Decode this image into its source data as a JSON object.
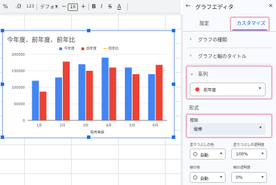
{
  "toolbar": {
    "format_123": "123",
    "font_name": "デフォ...",
    "minus": "−",
    "font_size": "10",
    "plus": "+",
    "bold": "B",
    "italic": "I",
    "strikethrough": "S",
    "text_color": "A"
  },
  "chart": {
    "title": "今年度、前年度、前年比",
    "legend": [
      {
        "name": "今年度",
        "color": "#4285f4",
        "kind": "box"
      },
      {
        "name": "前年度",
        "color": "#ea4335",
        "kind": "box"
      },
      {
        "name": "前年比",
        "color": "#fbbc04",
        "kind": "line"
      }
    ]
  },
  "chart_data": {
    "type": "bar",
    "title": "今年度、前年度、前年比",
    "xlabel": "販売実績",
    "ylabel": "",
    "categories": [
      "1月",
      "2月",
      "3月",
      "4月",
      "5月",
      "6月"
    ],
    "series": [
      {
        "name": "今年度",
        "color": "#4285f4",
        "values": [
          120000,
          130000,
          170000,
          190000,
          160000,
          140000
        ]
      },
      {
        "name": "前年度",
        "color": "#ea4335",
        "values": [
          87000,
          178000,
          150000,
          160000,
          140000,
          168000
        ]
      },
      {
        "name": "前年比",
        "color": "#fbbc04",
        "values": []
      }
    ],
    "yticks": [
      "0",
      "50000",
      "100000",
      "150000",
      "200000"
    ],
    "ylim": [
      0,
      200000
    ],
    "grid": true,
    "legend_position": "top"
  },
  "panel": {
    "title": "グラフエディタ",
    "back_icon": "arrow-back-icon",
    "close_icon": "close-icon",
    "tabs": {
      "setup": "設定",
      "customize": "カスタマイズ"
    },
    "sections": {
      "chart_style": "グラフの種類",
      "titles": "グラフと軸のタイトル",
      "series": "系列"
    },
    "series_select": {
      "value": "前年度",
      "dot_color": "#ea4335"
    },
    "format_heading": "形式",
    "type_label": "種類",
    "type_value": "縦棒",
    "fill_color_label": "塗りつぶしの色",
    "fill_opacity_label": "塗りつぶしの透明度",
    "fill_color_value": "自動",
    "fill_opacity_value": "100%",
    "line_color_label": "線の色",
    "line_opacity_label": "線の透明度",
    "line_color_value": "自動",
    "line_opacity_value": "0%",
    "highlight_color": "#eeb1cd",
    "accent_color": "#0b57d0"
  }
}
